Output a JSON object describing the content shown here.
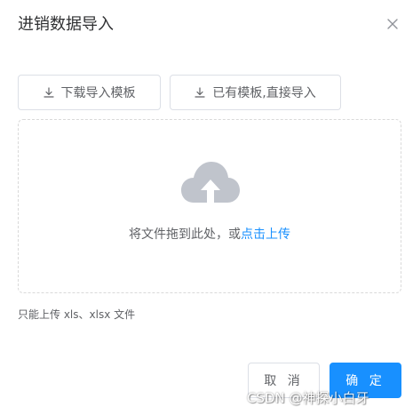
{
  "dialog": {
    "title": "进销数据导入"
  },
  "actions": {
    "download_template_label": "下载导入模板",
    "import_with_template_label": "已有模板,直接导入"
  },
  "upload": {
    "drag_text": "将文件拖到此处，或",
    "click_upload_text": "点击上传",
    "tip": "只能上传 xls、xlsx 文件"
  },
  "footer": {
    "cancel_label": "取 消",
    "confirm_label": "确 定"
  },
  "watermark": "CSDN @神探小白牙",
  "colors": {
    "primary": "#1890ff",
    "border": "#dcdfe6",
    "cloud": "#c0c4cc"
  },
  "icons": {
    "close": "close-icon",
    "download": "download-icon",
    "upload_cloud": "upload-cloud-icon"
  }
}
